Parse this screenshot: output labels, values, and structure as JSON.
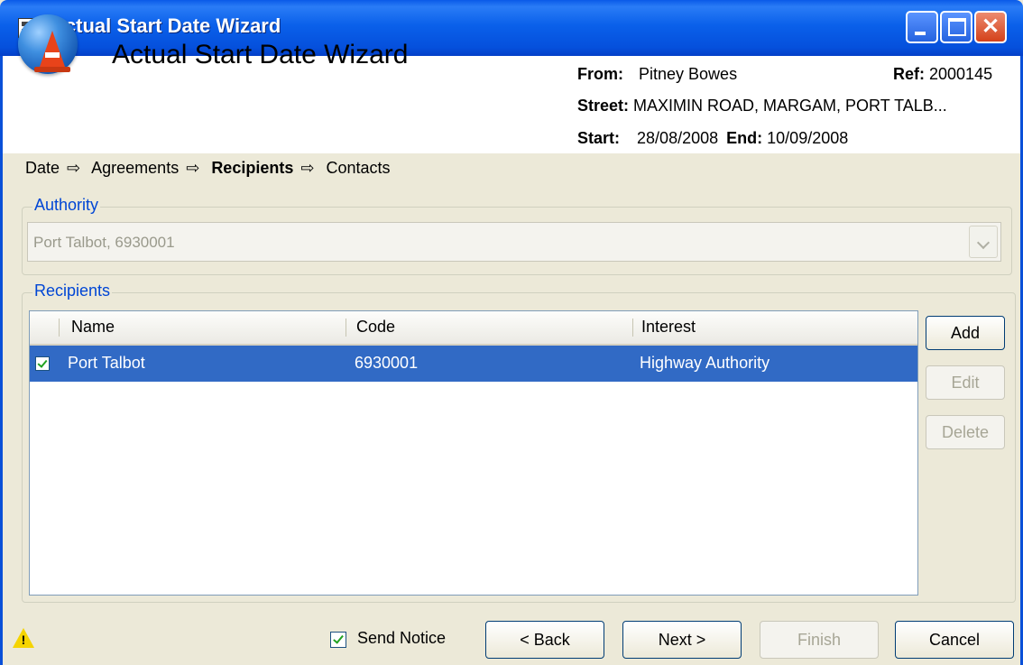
{
  "window": {
    "title": "Actual Start Date Wizard"
  },
  "header": {
    "title": "Actual Start Date Wizard",
    "from_label": "From:",
    "from_value": "Pitney Bowes",
    "ref_label": "Ref:",
    "ref_value": "2000145",
    "street_label": "Street:",
    "street_value": "MAXIMIN ROAD, MARGAM, PORT TALB...",
    "start_label": "Start:",
    "start_value": "28/08/2008",
    "end_label": "End:",
    "end_value": "10/09/2008"
  },
  "breadcrumb": {
    "steps": [
      "Date",
      "Agreements",
      "Recipients",
      "Contacts"
    ],
    "arrow": "⇨",
    "current_index": 2
  },
  "authority": {
    "label": "Authority",
    "selected": "Port Talbot, 6930001"
  },
  "recipients": {
    "label": "Recipients",
    "columns": [
      "Name",
      "Code",
      "Interest"
    ],
    "rows": [
      {
        "checked": true,
        "name": "Port Talbot",
        "code": "6930001",
        "interest": "Highway Authority"
      }
    ],
    "buttons": {
      "add": "Add",
      "edit": "Edit",
      "delete": "Delete"
    }
  },
  "footer": {
    "send_notice": "Send Notice",
    "send_notice_checked": true,
    "back": "< Back",
    "next": "Next >",
    "finish": "Finish",
    "cancel": "Cancel"
  },
  "colors": {
    "titlebar": "#0a5ae8",
    "selection": "#316ac5",
    "group_label": "#0046d5"
  }
}
